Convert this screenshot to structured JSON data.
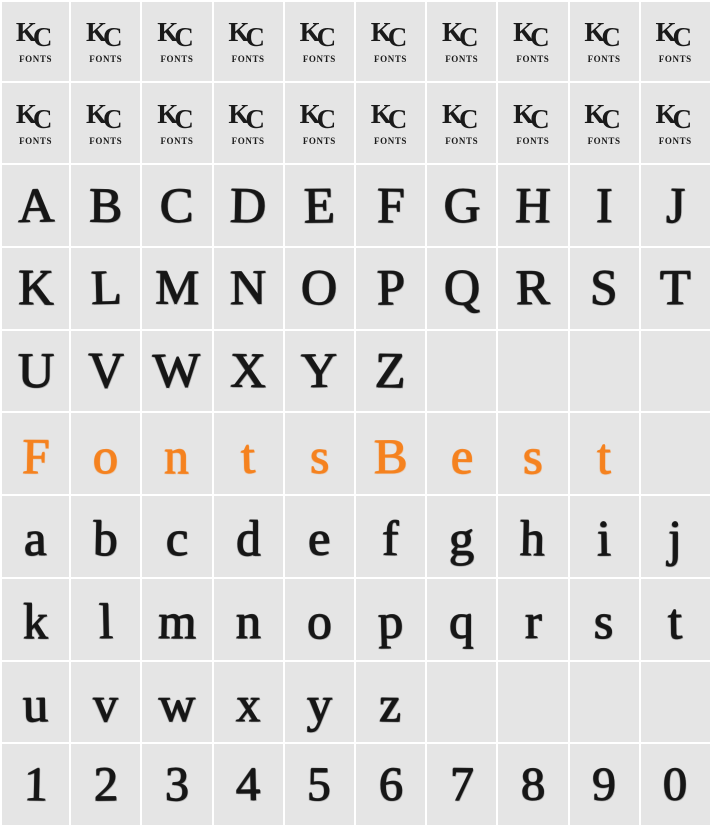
{
  "sheet": {
    "title": "KC Fonts character map specimen",
    "columns": 10,
    "rows": 10,
    "background_color": "#E5E5E5",
    "gridline_color": "#FFFFFF",
    "ink_color": "#161616",
    "accent_color": "#F5821F"
  },
  "logo": {
    "name": "KC FONTS",
    "letter_k": "K",
    "letter_c": "C",
    "wordmark": "FONTS"
  },
  "rows": [
    {
      "index": 0,
      "kind": "logo",
      "color": "#1A1A1A",
      "cells": [
        "logo",
        "logo",
        "logo",
        "logo",
        "logo",
        "logo",
        "logo",
        "logo",
        "logo",
        "logo"
      ]
    },
    {
      "index": 1,
      "kind": "logo",
      "color": "#1A1A1A",
      "cells": [
        "logo",
        "logo",
        "logo",
        "logo",
        "logo",
        "logo",
        "logo",
        "logo",
        "logo",
        "logo"
      ]
    },
    {
      "index": 2,
      "kind": "uppercase",
      "color": "#161616",
      "cells": [
        "A",
        "B",
        "C",
        "D",
        "E",
        "F",
        "G",
        "H",
        "I",
        "J"
      ]
    },
    {
      "index": 3,
      "kind": "uppercase",
      "color": "#161616",
      "cells": [
        "K",
        "L",
        "M",
        "N",
        "O",
        "P",
        "Q",
        "R",
        "S",
        "T"
      ]
    },
    {
      "index": 4,
      "kind": "uppercase",
      "color": "#161616",
      "cells": [
        "U",
        "V",
        "W",
        "X",
        "Y",
        "Z",
        "",
        "",
        "",
        ""
      ]
    },
    {
      "index": 5,
      "kind": "sample",
      "color": "#F5821F",
      "cells": [
        "F",
        "o",
        "n",
        "t",
        "s",
        "B",
        "e",
        "s",
        "t",
        ""
      ]
    },
    {
      "index": 6,
      "kind": "lowercase",
      "color": "#161616",
      "cells": [
        "a",
        "b",
        "c",
        "d",
        "e",
        "f",
        "g",
        "h",
        "i",
        "j"
      ]
    },
    {
      "index": 7,
      "kind": "lowercase",
      "color": "#161616",
      "cells": [
        "k",
        "l",
        "m",
        "n",
        "o",
        "p",
        "q",
        "r",
        "s",
        "t"
      ]
    },
    {
      "index": 8,
      "kind": "lowercase",
      "color": "#161616",
      "cells": [
        "u",
        "v",
        "w",
        "x",
        "y",
        "z",
        "",
        "",
        "",
        ""
      ]
    },
    {
      "index": 9,
      "kind": "digits",
      "color": "#161616",
      "cells": [
        "1",
        "2",
        "3",
        "4",
        "5",
        "6",
        "7",
        "8",
        "9",
        "0"
      ]
    }
  ],
  "sample_text": "FontsBest"
}
